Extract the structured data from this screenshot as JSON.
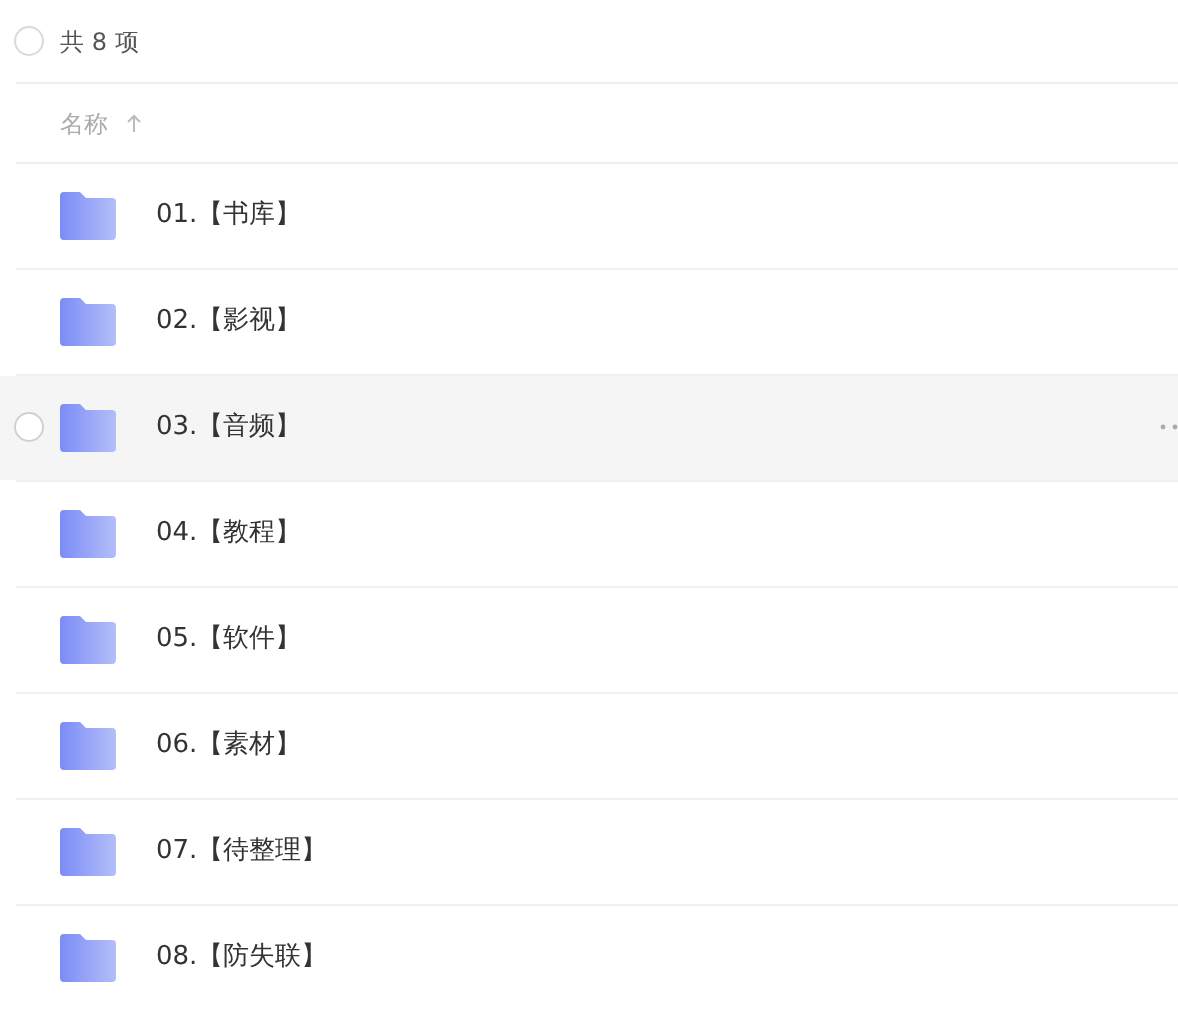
{
  "summary": {
    "label": "共 8 项",
    "checked": false
  },
  "column": {
    "label": "名称",
    "sort_ascending": true
  },
  "rows": [
    {
      "name": "01.【书库】",
      "hovered": false,
      "checked": false
    },
    {
      "name": "02.【影视】",
      "hovered": false,
      "checked": false
    },
    {
      "name": "03.【音频】",
      "hovered": true,
      "checked": false
    },
    {
      "name": "04.【教程】",
      "hovered": false,
      "checked": false
    },
    {
      "name": "05.【软件】",
      "hovered": false,
      "checked": false
    },
    {
      "name": "06.【素材】",
      "hovered": false,
      "checked": false
    },
    {
      "name": "07.【待整理】",
      "hovered": false,
      "checked": false
    },
    {
      "name": "08.【防失联】",
      "hovered": false,
      "checked": false
    }
  ]
}
